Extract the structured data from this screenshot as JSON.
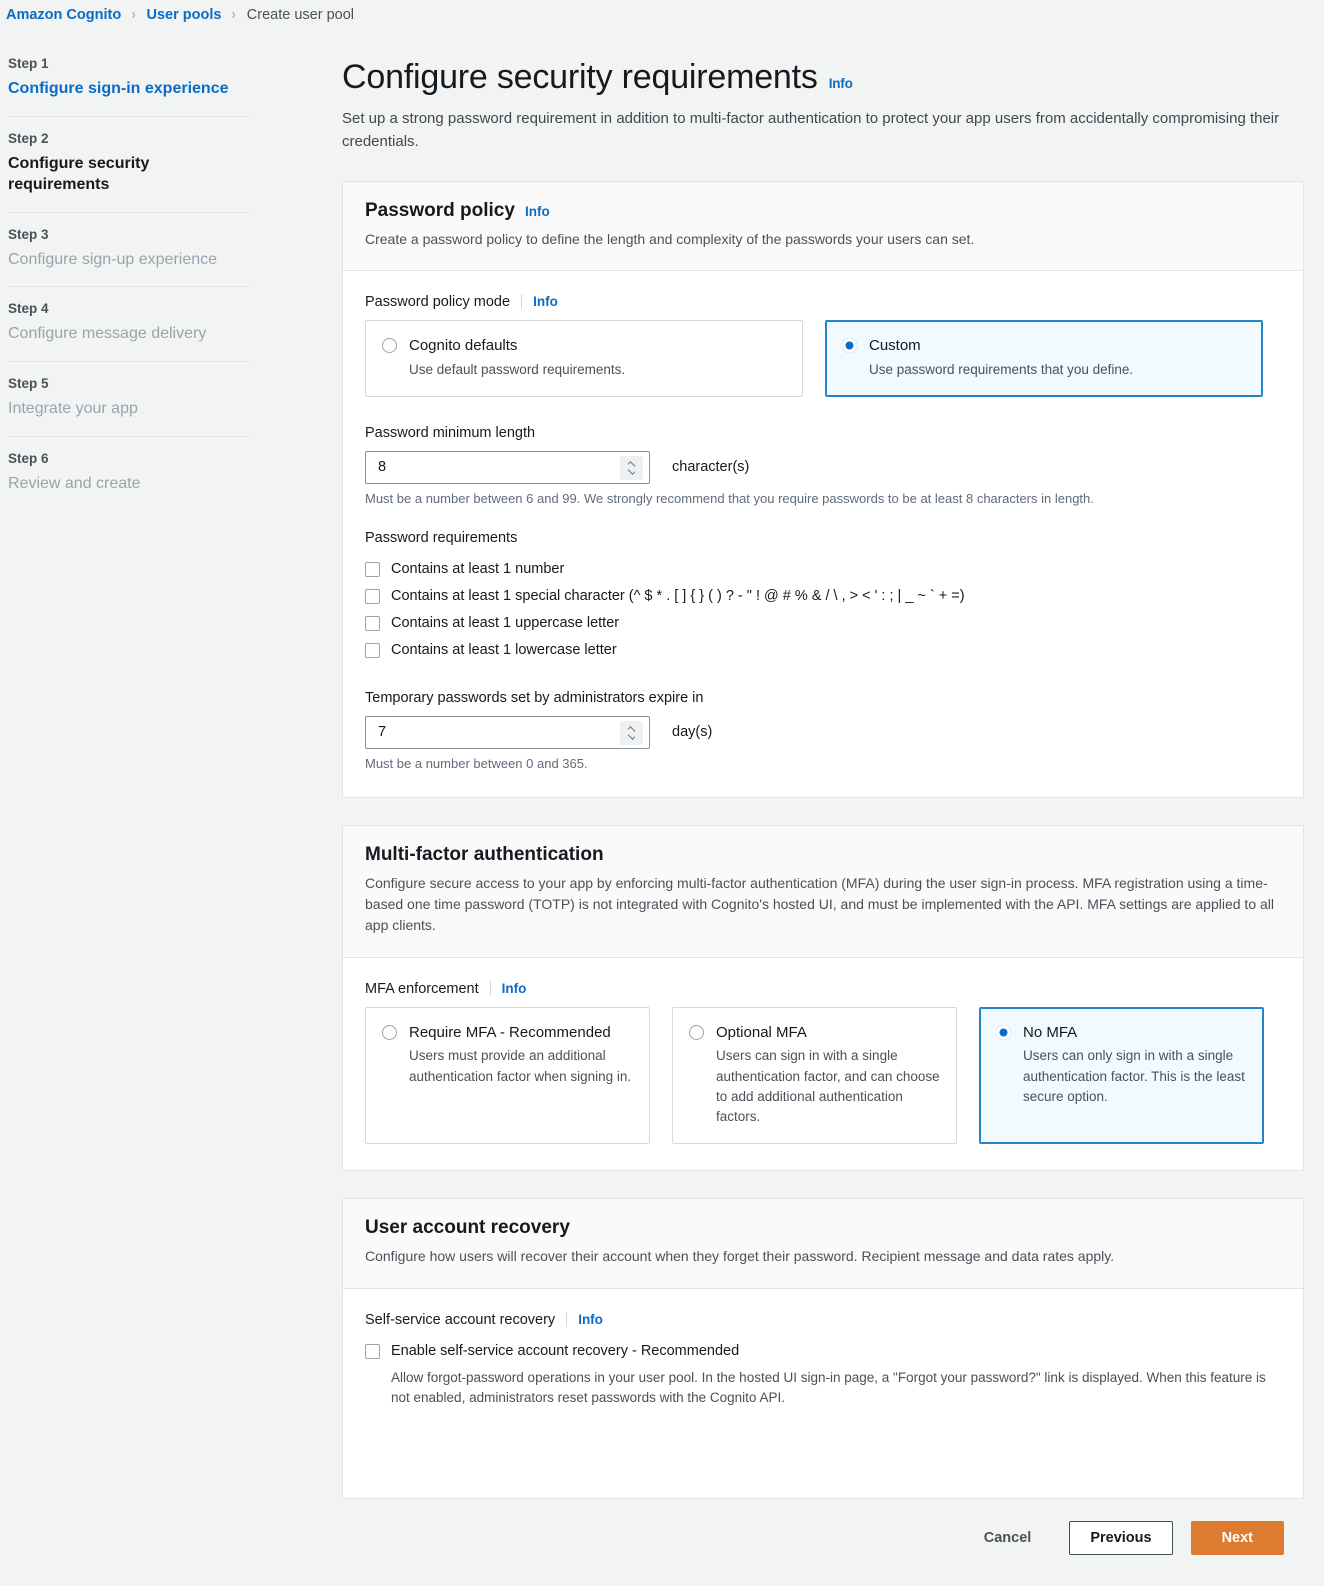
{
  "breadcrumb": {
    "items": [
      {
        "label": "Amazon Cognito",
        "type": "link"
      },
      {
        "label": "User pools",
        "type": "link"
      },
      {
        "label": "Create user pool",
        "type": "current"
      }
    ],
    "separator": "›"
  },
  "sidebar": {
    "steps": [
      {
        "num": "Step 1",
        "label": "Configure sign-in experience",
        "state": "link"
      },
      {
        "num": "Step 2",
        "label": "Configure security requirements",
        "state": "active"
      },
      {
        "num": "Step 3",
        "label": "Configure sign-up experience",
        "state": "muted"
      },
      {
        "num": "Step 4",
        "label": "Configure message delivery",
        "state": "muted"
      },
      {
        "num": "Step 5",
        "label": "Integrate your app",
        "state": "muted"
      },
      {
        "num": "Step 6",
        "label": "Review and create",
        "state": "muted"
      }
    ]
  },
  "header": {
    "title": "Configure security requirements",
    "info": "Info",
    "description": "Set up a strong password requirement in addition to multi-factor authentication to protect your app users from accidentally compromising their credentials."
  },
  "password_policy": {
    "title": "Password policy",
    "info": "Info",
    "subtitle": "Create a password policy to define the length and complexity of the passwords your users can set.",
    "mode_label": "Password policy mode",
    "mode_info": "Info",
    "modes": [
      {
        "title": "Cognito defaults",
        "desc": "Use default password requirements.",
        "selected": false
      },
      {
        "title": "Custom",
        "desc": "Use password requirements that you define.",
        "selected": true
      }
    ],
    "min_length_label": "Password minimum length",
    "min_length_value": "8",
    "min_length_unit": "character(s)",
    "min_length_help": "Must be a number between 6 and 99. We strongly recommend that you require passwords to be at least 8 characters in length.",
    "requirements_label": "Password requirements",
    "requirements": [
      {
        "label": "Contains at least 1 number",
        "checked": false
      },
      {
        "label": "Contains at least 1 special character (^ $ * . [ ] { } ( ) ? - \" ! @ # % & / \\ , > < ' : ; | _ ~ ` + =)",
        "checked": false
      },
      {
        "label": "Contains at least 1 uppercase letter",
        "checked": false
      },
      {
        "label": "Contains at least 1 lowercase letter",
        "checked": false
      }
    ],
    "temp_label": "Temporary passwords set by administrators expire in",
    "temp_value": "7",
    "temp_unit": "day(s)",
    "temp_help": "Must be a number between 0 and 365."
  },
  "mfa": {
    "title": "Multi-factor authentication",
    "subtitle": "Configure secure access to your app by enforcing multi-factor authentication (MFA) during the user sign-in process. MFA registration using a time-based one time password (TOTP) is not integrated with Cognito's hosted UI, and must be implemented with the API. MFA settings are applied to all app clients.",
    "enforcement_label": "MFA enforcement",
    "enforcement_info": "Info",
    "options": [
      {
        "title": "Require MFA - Recommended",
        "desc": "Users must provide an additional authentication factor when signing in.",
        "selected": false
      },
      {
        "title": "Optional MFA",
        "desc": "Users can sign in with a single authentication factor, and can choose to add additional authentication factors.",
        "selected": false
      },
      {
        "title": "No MFA",
        "desc": "Users can only sign in with a single authentication factor. This is the least secure option.",
        "selected": true
      }
    ]
  },
  "recovery": {
    "title": "User account recovery",
    "subtitle": "Configure how users will recover their account when they forget their password. Recipient message and data rates apply.",
    "self_service_label": "Self-service account recovery",
    "self_service_info": "Info",
    "enable_label": "Enable self-service account recovery - Recommended",
    "enable_desc": "Allow forgot-password operations in your user pool. In the hosted UI sign-in page, a \"Forgot your password?\" link is displayed. When this feature is not enabled, administrators reset passwords with the Cognito API.",
    "enable_checked": false
  },
  "footer": {
    "cancel": "Cancel",
    "previous": "Previous",
    "next": "Next"
  },
  "colors": {
    "link_blue": "#0a6cc4",
    "selected_border": "#2086c7",
    "selected_bg": "#f1faff",
    "primary_orange": "#dd7b30",
    "page_bg": "#f2f3f3"
  }
}
